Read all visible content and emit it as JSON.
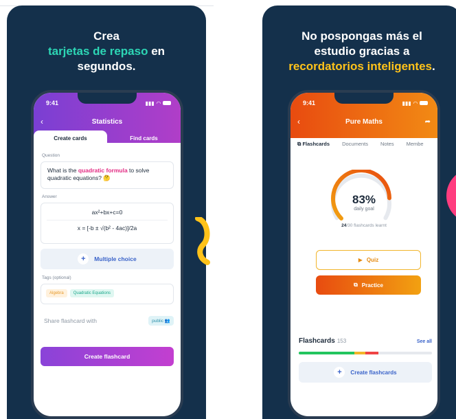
{
  "left": {
    "headline": {
      "line1": "Crea",
      "line2_highlight": "tarjetas de repaso",
      "line2_rest": " en",
      "line3": "segundos."
    },
    "status": {
      "time": "9:41"
    },
    "nav": {
      "title": "Statistics"
    },
    "tabs": [
      {
        "label": "Create cards"
      },
      {
        "label": "Find cards"
      }
    ],
    "question": {
      "label": "Question",
      "text_before": "What is the ",
      "text_highlight": "quadratic formula",
      "text_after": " to solve quadratic equations? 🤔"
    },
    "answer": {
      "label": "Answer",
      "line1": "ax²+bx+c=0",
      "line2": "x = [-b ± √(b² - 4ac)]/2a"
    },
    "multiple_choice": {
      "label": "Multiple choice"
    },
    "tags": {
      "label": "Tags (optional)",
      "items": [
        "Algebra",
        "Quadratic Equations"
      ]
    },
    "share": {
      "label": "Share flashcard with",
      "badge": "public 👥"
    },
    "create_button": "Create flashcard"
  },
  "right": {
    "headline": {
      "line1": "No pospongas más el",
      "line2": "estudio gracias a",
      "line3_highlight": "recordatorios inteligentes",
      "line3_rest": "."
    },
    "status": {
      "time": "9:41"
    },
    "nav": {
      "title": "Pure Maths"
    },
    "subtabs": [
      "Flashcards",
      "Documents",
      "Notes",
      "Membe"
    ],
    "goal": {
      "percent_text": "83%",
      "percent_value": 0.83,
      "label": "daily goal"
    },
    "learnt": {
      "count": "24",
      "rest": "/30 flashcards learnt"
    },
    "quiz_label": "Quiz",
    "practice_label": "Practice",
    "flashcards": {
      "title": "Flashcards",
      "count": "153",
      "see_all": "See all"
    },
    "progress_segments": [
      {
        "fraction": 0.42,
        "color": "#22c55e"
      },
      {
        "fraction": 0.08,
        "color": "#f2b52b"
      },
      {
        "fraction": 0.1,
        "color": "#ef4444"
      }
    ],
    "create_label": "Create flashcards"
  },
  "colors": {
    "bg_navy": "#14304b",
    "teal": "#2dd6b5",
    "yellow": "#ffc21a",
    "purple": "#8a43d8",
    "orange": "#e84b10",
    "link_blue": "#3a63c9"
  }
}
